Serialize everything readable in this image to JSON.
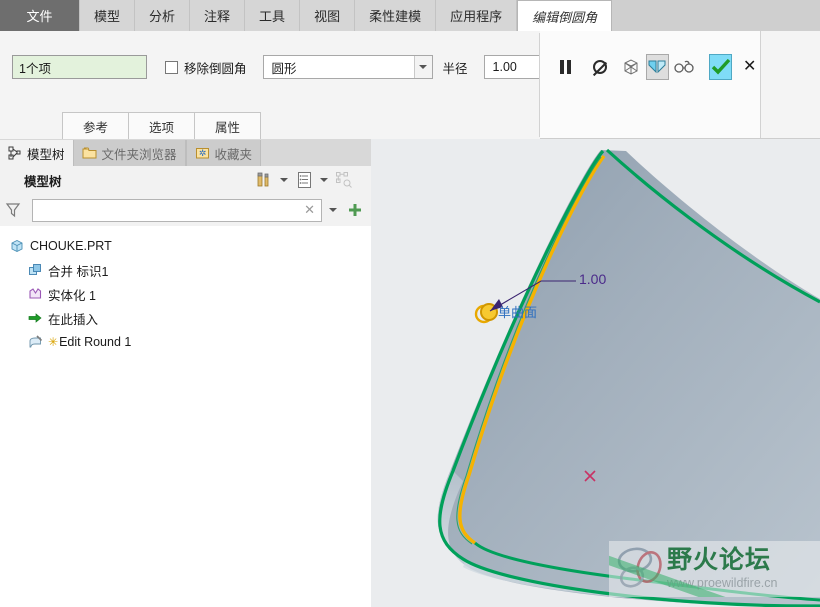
{
  "ribbon": {
    "tabs": [
      {
        "label": "文件",
        "state": "file"
      },
      {
        "label": "模型",
        "state": "plain"
      },
      {
        "label": "分析",
        "state": "plain"
      },
      {
        "label": "注释",
        "state": "plain"
      },
      {
        "label": "工具",
        "state": "plain"
      },
      {
        "label": "视图",
        "state": "plain"
      },
      {
        "label": "柔性建模",
        "state": "plain"
      },
      {
        "label": "应用程序",
        "state": "plain"
      },
      {
        "label": "编辑倒圆角",
        "state": "active"
      }
    ]
  },
  "dashboard": {
    "reference_value": "1个项",
    "remove_round_label": "移除倒圆角",
    "remove_round_checked": false,
    "shape_value": "圆形",
    "radius_label": "半径",
    "radius_value": "1.00",
    "icons": [
      {
        "name": "pause-icon",
        "title": "暂停"
      },
      {
        "name": "no-entry-icon",
        "title": "取消"
      },
      {
        "name": "wireframe-cube-icon",
        "title": "线框"
      },
      {
        "name": "chamfer-preview-icon",
        "title": "预览几何"
      },
      {
        "name": "glasses-icon",
        "title": "查看"
      },
      {
        "name": "accept-check-icon",
        "title": "确定"
      },
      {
        "name": "cancel-x-icon",
        "title": "取消"
      }
    ],
    "subtabs": [
      {
        "label": "参考"
      },
      {
        "label": "选项"
      },
      {
        "label": "属性"
      }
    ]
  },
  "left_panel": {
    "tabs": [
      {
        "label": "模型树",
        "icon": "tree-icon",
        "active": true
      },
      {
        "label": "文件夹浏览器",
        "icon": "folder-icon",
        "active": false
      },
      {
        "label": "收藏夹",
        "icon": "favorites-folder-icon",
        "active": false
      }
    ],
    "tree_title": "模型树",
    "header_icons": [
      {
        "name": "tools-icon"
      },
      {
        "name": "tools-chevron-down-icon"
      },
      {
        "name": "settings-list-icon"
      },
      {
        "name": "settings-chevron-down-icon"
      },
      {
        "name": "tree-filter-disabled-icon"
      }
    ],
    "search": {
      "value": "",
      "placeholder": "",
      "clear_glyph": "✕",
      "filter_icon": "funnel-icon",
      "dropdown_icon": "chevron-down-icon",
      "add_icon": "plus-icon"
    },
    "tree": [
      {
        "label": "CHOUKE.PRT",
        "icon": "part-cube-icon",
        "indent": 0,
        "prefix": ""
      },
      {
        "label": "合并 标识1",
        "icon": "merge-icon",
        "indent": 1,
        "prefix": ""
      },
      {
        "label": "实体化 1",
        "icon": "solidify-icon",
        "indent": 1,
        "prefix": ""
      },
      {
        "label": "在此插入",
        "icon": "insert-here-arrow-icon",
        "indent": 1,
        "prefix": ""
      },
      {
        "label": "Edit Round 1",
        "icon": "round-feature-icon",
        "indent": 1,
        "prefix": "✳"
      }
    ]
  },
  "viewport": {
    "dimension_label": "1.00",
    "surface_label": "单曲面",
    "colors": {
      "background": "#eaecee",
      "surface": "#9fadbb",
      "highlight_edge": "#00a05a",
      "fillet_edge": "#f5b301",
      "dimension_text": "#4b2a8a",
      "surface_text": "#2f6fbf",
      "datum_point": "#c83264"
    }
  },
  "watermark": {
    "title": "野火论坛",
    "url": "www.proewildfire.cn"
  }
}
